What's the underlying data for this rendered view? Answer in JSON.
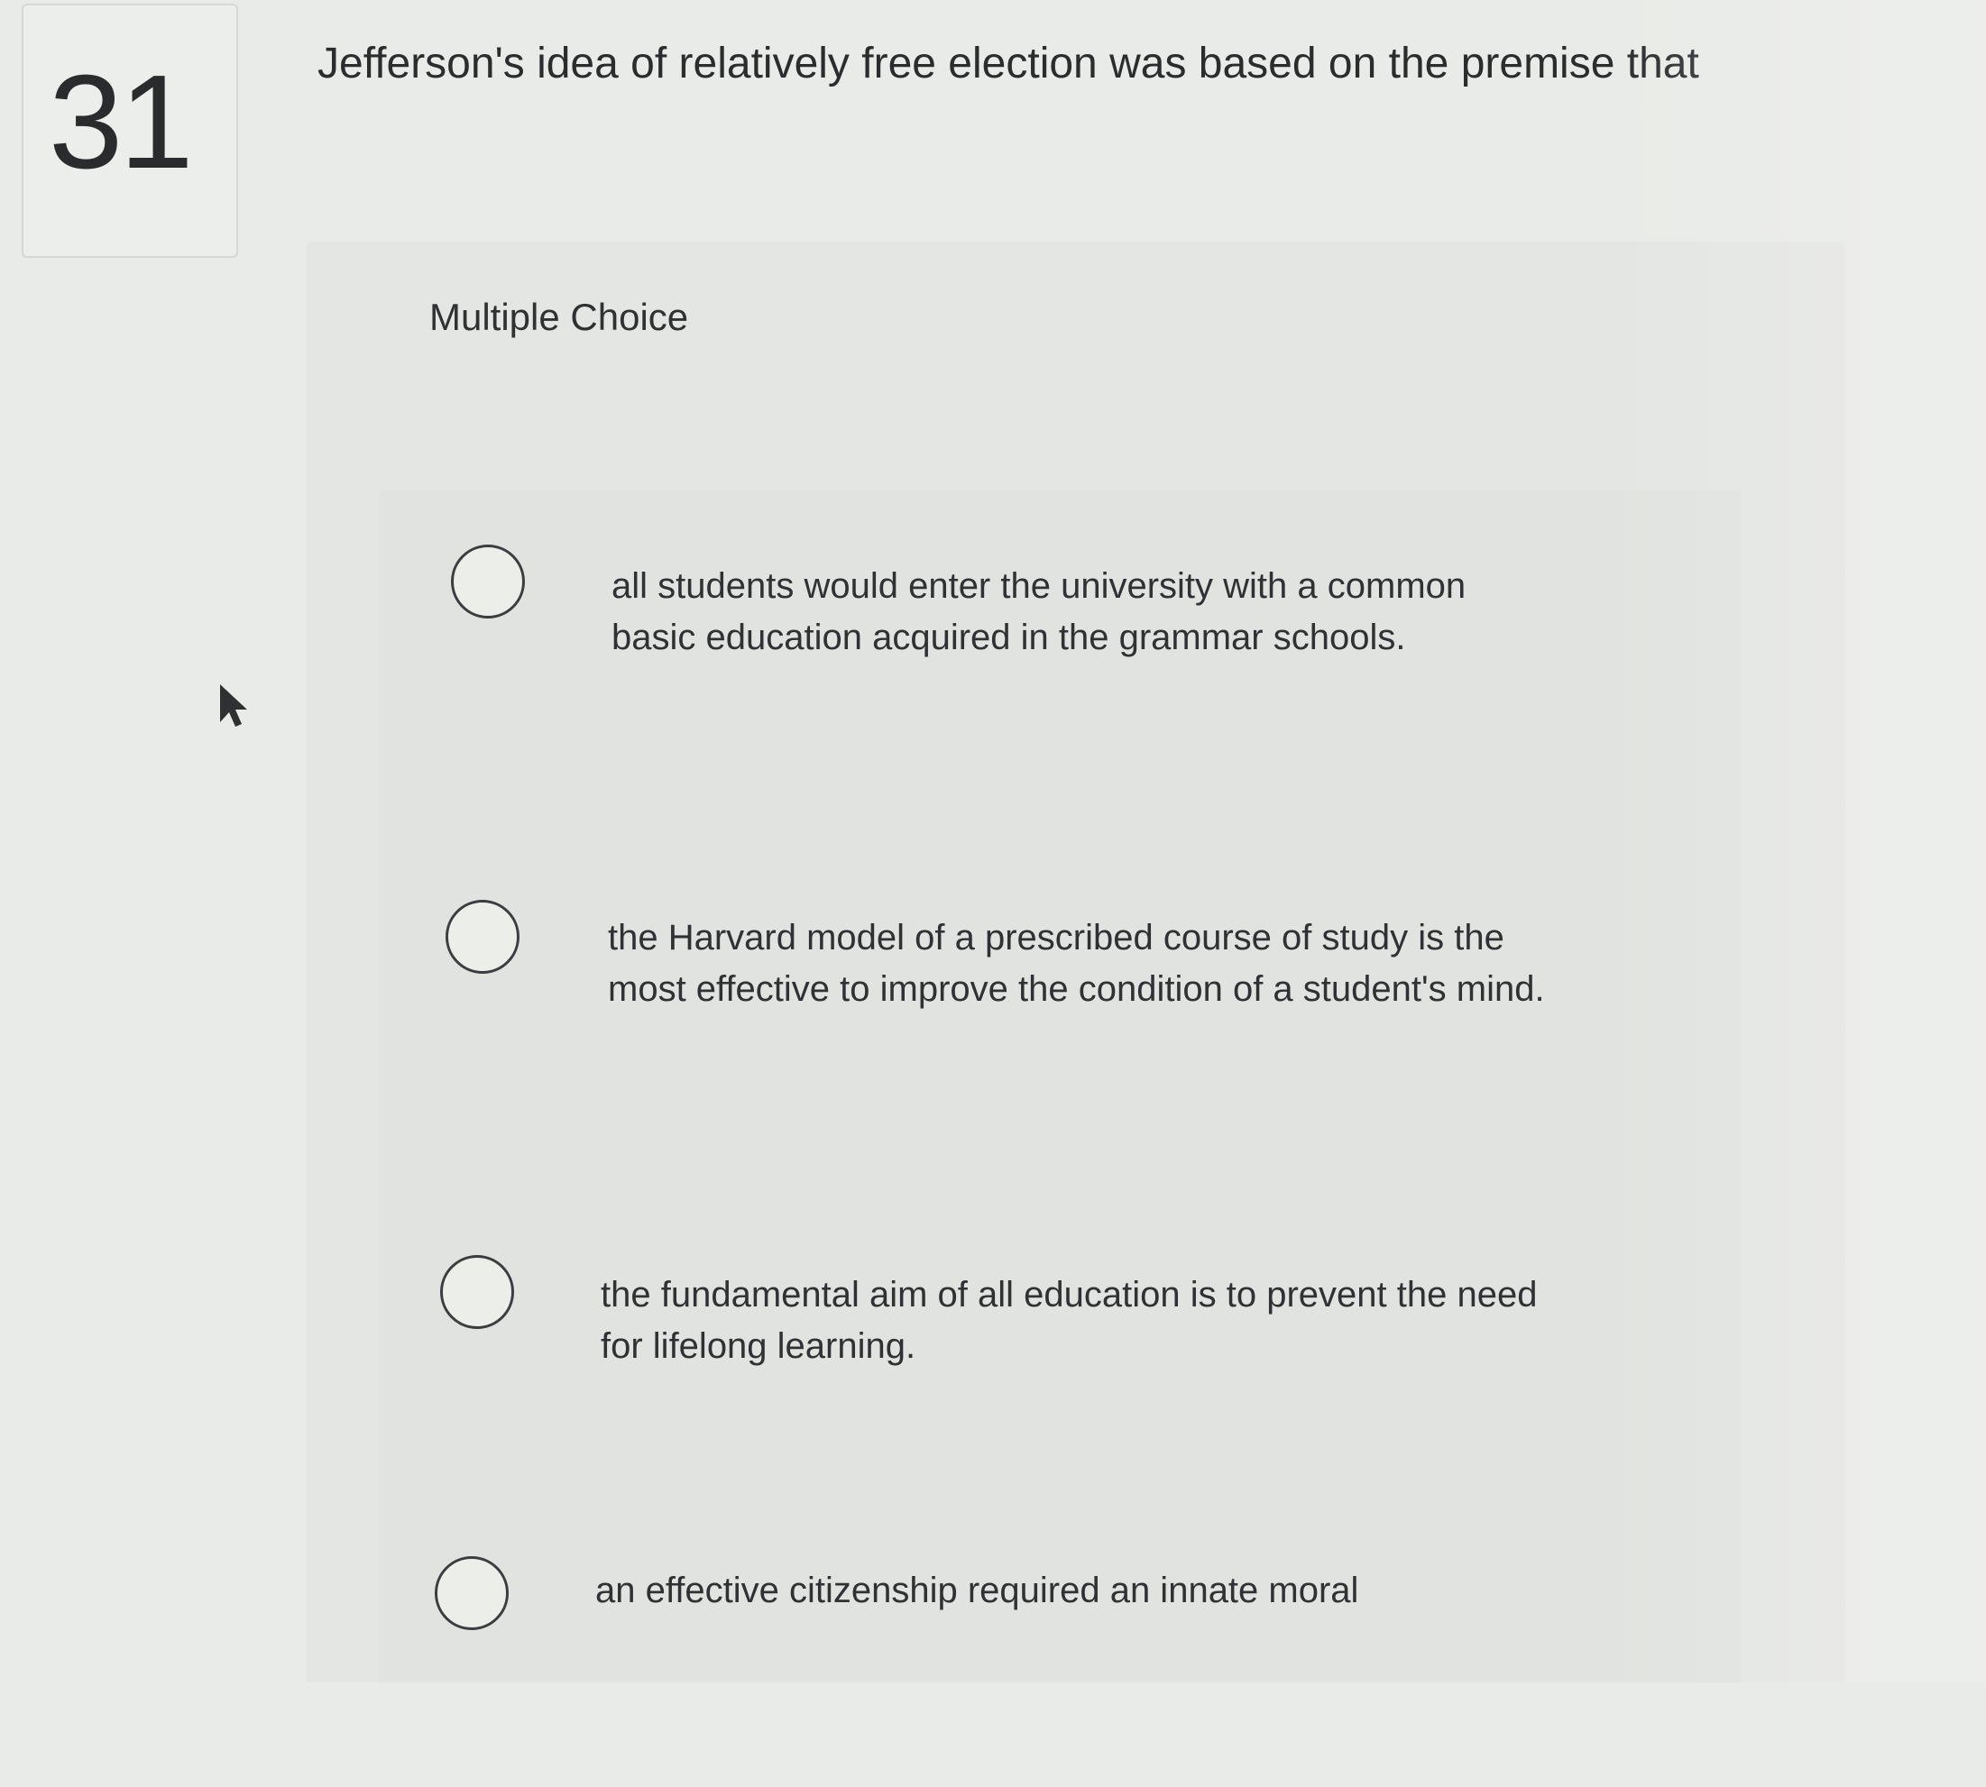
{
  "question": {
    "number": "31",
    "prompt": "Jefferson's idea of relatively free election was based on the premise that",
    "type": "Multiple Choice"
  },
  "choices": [
    {
      "text": "all students would enter the university with a common basic education acquired in the grammar schools."
    },
    {
      "text": "the Harvard model of a prescribed course of study is the most effective to improve the condition of a student's mind."
    },
    {
      "text": "the fundamental aim of all education is to prevent the need for lifelong learning."
    },
    {
      "text": "an effective citizenship required an innate moral"
    }
  ],
  "colors": {
    "page_background": "#e9ebe8",
    "panel_background": "#e4e6e3",
    "text": "#2b2d2f",
    "radio_outline": "#3b3d40"
  },
  "icons": {
    "cursor": "mouse-pointer-icon",
    "radio": "radio-button-icon"
  }
}
